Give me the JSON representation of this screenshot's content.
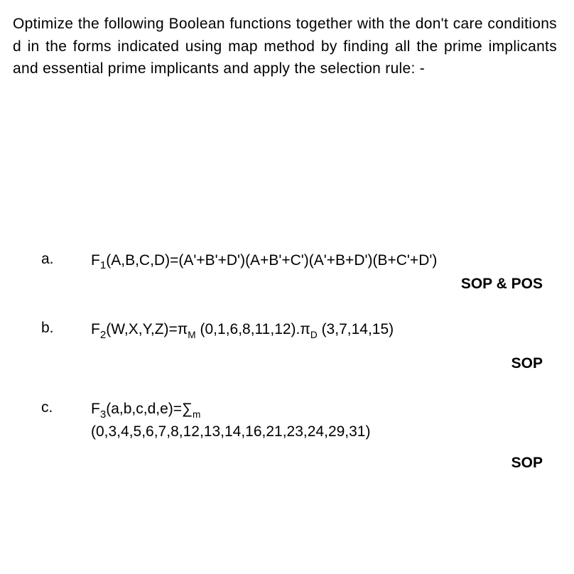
{
  "intro": "Optimize the following Boolean functions together with the don't care conditions d in the forms indicated using map method by finding all the prime implicants and essential prime implicants and apply the selection rule: -",
  "problems": [
    {
      "label": "a.",
      "func_name": "F",
      "func_sub": "1",
      "vars": "(A,B,C,D)",
      "expr": "=(A'+B'+D')(A+B'+C')(A'+B+D')(B+C'+D')",
      "form": "SOP & POS"
    },
    {
      "label": "b.",
      "func_name": "F",
      "func_sub": "2",
      "vars": "(W,X,Y,Z)",
      "expr_prefix": "=π",
      "expr_sub1": "M",
      "expr_mid": " (0,1,6,8,11,12).π",
      "expr_sub2": "D",
      "expr_suffix": " (3,7,14,15)",
      "form": "SOP"
    },
    {
      "label": "c.",
      "func_name": "F",
      "func_sub": "3",
      "vars": "(a,b,c,d,e)",
      "expr_prefix": "=∑",
      "expr_sub1": "m",
      "line2": "(0,3,4,5,6,7,8,12,13,14,16,21,23,24,29,31)",
      "form": "SOP"
    }
  ]
}
